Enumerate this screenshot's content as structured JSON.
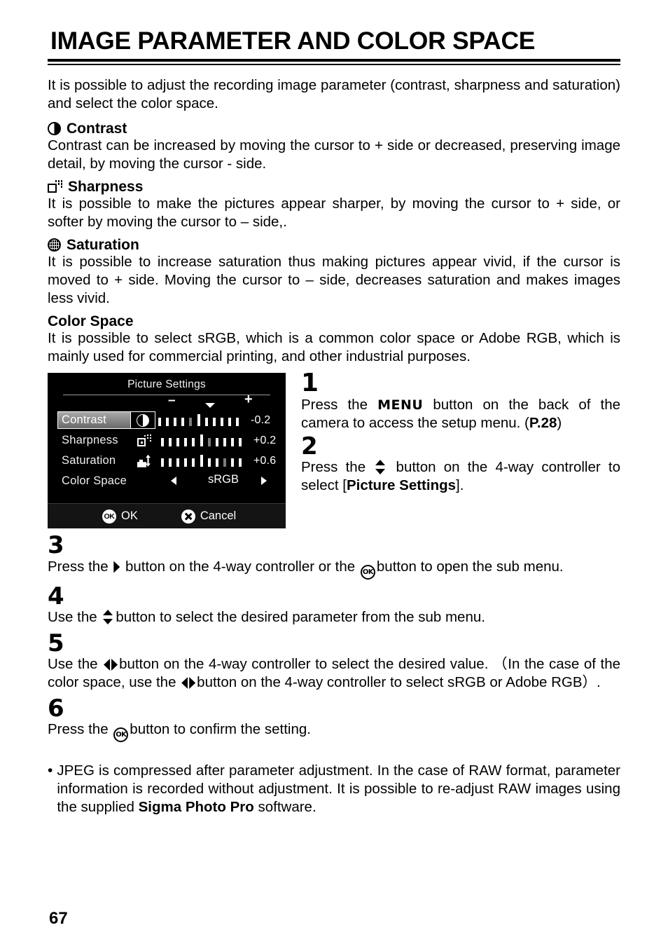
{
  "page": {
    "title": "IMAGE PARAMETER AND COLOR SPACE",
    "intro": "It is possible to adjust the recording image parameter (contrast, sharpness and saturation) and select the color space.",
    "page_number": "67"
  },
  "sections": [
    {
      "icon": "contrast-icon",
      "heading": "Contrast",
      "body": "Contrast can be increased by moving the cursor to + side or decreased, preserving image detail, by moving the cursor - side."
    },
    {
      "icon": "sharpness-icon",
      "heading": "Sharpness",
      "body": "It is possible to make the pictures appear sharper, by moving the cursor to + side, or softer by moving the cursor to – side,."
    },
    {
      "icon": "saturation-icon",
      "heading": "Saturation",
      "body": "It is possible to increase saturation thus making pictures appear vivid, if the cursor is moved to + side. Moving the cursor to – side, decreases saturation and makes images less vivid."
    },
    {
      "icon": "none",
      "heading": "Color Space",
      "body": "It is possible to select sRGB, which is a common color space or Adobe RGB, which is mainly used for commercial printing, and other industrial purposes."
    }
  ],
  "lcd": {
    "title": "Picture Settings",
    "minus_label": "–",
    "plus_label": "+",
    "rows": [
      {
        "name": "Contrast",
        "icon": "contrast-icon",
        "value": "-0.2",
        "ticks": 11,
        "center_index": 5,
        "current_index": 4,
        "selected": true
      },
      {
        "name": "Sharpness",
        "icon": "sharpness-icon",
        "value": "+0.2",
        "ticks": 11,
        "center_index": 5,
        "current_index": 6,
        "selected": false
      },
      {
        "name": "Saturation",
        "icon": "saturation-icon",
        "value": "+0.6",
        "ticks": 11,
        "center_index": 5,
        "current_index": 8,
        "selected": false
      }
    ],
    "color_space": {
      "name": "Color Space",
      "value": "sRGB",
      "left_arrow": "left-arrow-icon",
      "right_arrow": "right-arrow-icon"
    },
    "footer": {
      "ok_badge": "OK",
      "ok_label": "OK",
      "cancel_badge": "close-icon",
      "cancel_label": "Cancel"
    }
  },
  "steps": [
    {
      "number": "1",
      "text_before": "Press the ",
      "glyph": "MENU",
      "text_after": " button on the back of the camera to access the setup menu. (",
      "bold_ref": "P.28",
      "text_end": ")"
    },
    {
      "number": "2",
      "text_before": "Press the ",
      "glyph": "up-down-arrow-icon",
      "text_after": " button on the 4-way controller to select [",
      "bold_ref": "Picture Settings",
      "text_end": "]."
    },
    {
      "number": "3",
      "text_before": "Press the ",
      "glyph": "right-arrow-icon",
      "text_mid": " button on the 4-way controller or the ",
      "glyph2": "ok-button-icon",
      "text_after": "button to open the sub menu."
    },
    {
      "number": "4",
      "text_before": "Use the ",
      "glyph": "up-down-arrow-icon",
      "text_after": "button to select the desired parameter from the sub menu."
    },
    {
      "number": "5",
      "text_before": "Use the ",
      "glyph": "left-right-arrow-icon",
      "text_mid": "button on the 4-way controller to select the desired value. （In the case of the color space, use the ",
      "glyph2": "left-right-arrow-icon",
      "text_after": "button on the 4-way controller to select sRGB or Adobe RGB）."
    },
    {
      "number": "6",
      "text_before": "Press the ",
      "glyph": "ok-button-icon",
      "text_after": "button to confirm the setting."
    }
  ],
  "note": {
    "bullet": "•",
    "part1": "JPEG is compressed after parameter adjustment. In the case of RAW format, parameter information is recorded without adjustment. It is possible to re-adjust RAW images using the supplied ",
    "bold": "Sigma Photo Pro",
    "part2": " software."
  }
}
